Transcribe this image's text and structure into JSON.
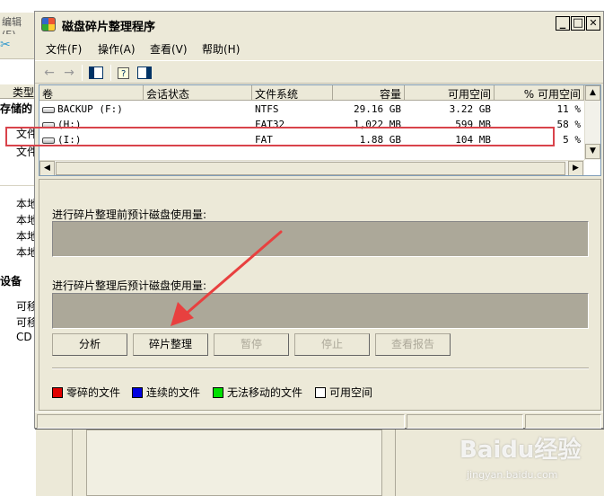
{
  "background_window": {
    "menu_fragment": "编辑(E)",
    "header_label": "类型",
    "section_stored": "存储的",
    "rows": [
      "文件",
      "文件",
      "本地",
      "本地",
      "本地",
      "本地"
    ],
    "section_devices": "设备",
    "device_rows": [
      "可移",
      "可移",
      "CD"
    ]
  },
  "window": {
    "title": "磁盘碎片整理程序",
    "min_label": "_",
    "max_label": "□",
    "close_label": "✕"
  },
  "menu": {
    "file": "文件(F)",
    "action": "操作(A)",
    "view": "查看(V)",
    "help": "帮助(H)"
  },
  "columns": [
    "卷",
    "会话状态",
    "文件系统",
    "容量",
    "可用空间",
    "% 可用空间"
  ],
  "volumes": [
    {
      "name": "BACKUP (F:)",
      "status": "",
      "fs": "NTFS",
      "capacity": "29.16 GB",
      "free": "3.22 GB",
      "pct": "11 %"
    },
    {
      "name": "(H:)",
      "status": "",
      "fs": "FAT32",
      "capacity": "1,022 MB",
      "free": "599 MB",
      "pct": "58 %"
    },
    {
      "name": "(I:)",
      "status": "",
      "fs": "FAT",
      "capacity": "1.88 GB",
      "free": "104 MB",
      "pct": "5 %"
    }
  ],
  "usage": {
    "before_label": "进行碎片整理前预计磁盘使用量:",
    "after_label": "进行碎片整理后预计磁盘使用量:"
  },
  "buttons": {
    "analyze": "分析",
    "defrag": "碎片整理",
    "pause": "暂停",
    "stop": "停止",
    "report": "查看报告"
  },
  "legend": [
    {
      "label": "零碎的文件",
      "color": "#e00000"
    },
    {
      "label": "连续的文件",
      "color": "#0000e0"
    },
    {
      "label": "无法移动的文件",
      "color": "#00e000"
    },
    {
      "label": "可用空间",
      "color": "#ffffff"
    }
  ],
  "colors": {
    "highlight": "#d9434b",
    "arrow": "#e8403f"
  },
  "watermark": {
    "text": "Baidu经验",
    "url": "jingyan.baidu.com"
  }
}
